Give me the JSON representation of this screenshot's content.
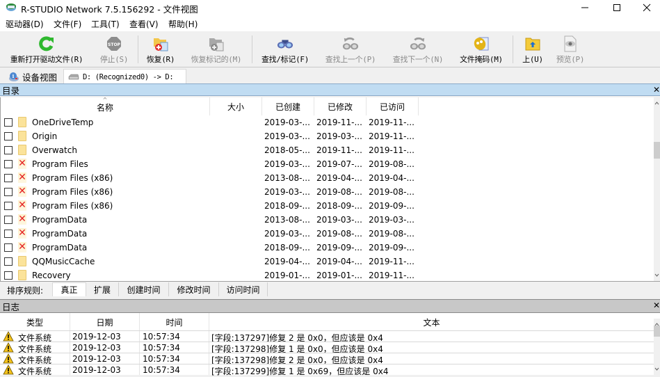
{
  "window": {
    "title": "R-STUDIO Network 7.5.156292 - 文件视图",
    "controls": {
      "minimize": "—",
      "maximize": "☐",
      "close": "✕"
    }
  },
  "menu": [
    {
      "label": "驱动器(D)"
    },
    {
      "label": "文件(F)"
    },
    {
      "label": "工具(T)"
    },
    {
      "label": "查看(V)"
    },
    {
      "label": "帮助(H)"
    }
  ],
  "toolbar": [
    {
      "label": "重新打开驱动文件(R)",
      "icon": "refresh-icon",
      "enabled": true
    },
    {
      "label": "停止(S)",
      "icon": "stop-icon",
      "enabled": false
    },
    {
      "label": "恢复(R)",
      "icon": "recover-icon",
      "enabled": true
    },
    {
      "label": "恢复标记的(M)",
      "icon": "recover-marked-icon",
      "enabled": false
    },
    {
      "label": "查找/标记(F)",
      "icon": "binoculars-icon",
      "enabled": true
    },
    {
      "label": "查找上一个(P)",
      "icon": "find-previous-icon",
      "enabled": false
    },
    {
      "label": "查找下一个(N)",
      "icon": "find-next-icon",
      "enabled": false
    },
    {
      "label": "文件掩码(M)",
      "icon": "file-mask-icon",
      "enabled": true
    },
    {
      "label": "上(U)",
      "icon": "folder-up-icon",
      "enabled": true
    },
    {
      "label": "预览(P)",
      "icon": "preview-icon",
      "enabled": false
    }
  ],
  "tabs": [
    {
      "label": "设备视图",
      "icon": "device-view-icon",
      "active": false
    },
    {
      "label": "D: (Recognized0) -> D:",
      "icon": "drive-icon",
      "active": true
    }
  ],
  "directory": {
    "title": "目录",
    "close": "✕",
    "columns": [
      "名称",
      "大小",
      "已创建",
      "已修改",
      "已访问"
    ],
    "rows": [
      {
        "name": "OneDriveTemp",
        "deleted": false,
        "size": "",
        "created": "2019-03-...",
        "modified": "2019-11-...",
        "accessed": "2019-11-..."
      },
      {
        "name": "Origin",
        "deleted": false,
        "size": "",
        "created": "2019-03-...",
        "modified": "2019-03-...",
        "accessed": "2019-11-..."
      },
      {
        "name": "Overwatch",
        "deleted": false,
        "size": "",
        "created": "2018-05-...",
        "modified": "2019-11-...",
        "accessed": "2019-11-..."
      },
      {
        "name": "Program Files",
        "deleted": true,
        "size": "",
        "created": "2019-03-...",
        "modified": "2019-07-...",
        "accessed": "2019-08-..."
      },
      {
        "name": "Program Files (x86)",
        "deleted": true,
        "size": "",
        "created": "2013-08-...",
        "modified": "2019-04-...",
        "accessed": "2019-04-..."
      },
      {
        "name": "Program Files (x86)",
        "deleted": true,
        "size": "",
        "created": "2019-03-...",
        "modified": "2019-08-...",
        "accessed": "2019-08-..."
      },
      {
        "name": "Program Files (x86)",
        "deleted": true,
        "size": "",
        "created": "2018-09-...",
        "modified": "2018-09-...",
        "accessed": "2019-09-..."
      },
      {
        "name": "ProgramData",
        "deleted": true,
        "size": "",
        "created": "2013-08-...",
        "modified": "2019-03-...",
        "accessed": "2019-03-..."
      },
      {
        "name": "ProgramData",
        "deleted": true,
        "size": "",
        "created": "2019-03-...",
        "modified": "2019-08-...",
        "accessed": "2019-08-..."
      },
      {
        "name": "ProgramData",
        "deleted": true,
        "size": "",
        "created": "2018-09-...",
        "modified": "2019-09-...",
        "accessed": "2019-09-..."
      },
      {
        "name": "QQMusicCache",
        "deleted": false,
        "size": "",
        "created": "2019-04-...",
        "modified": "2019-04-...",
        "accessed": "2019-11-..."
      },
      {
        "name": "Recovery",
        "deleted": false,
        "size": "",
        "created": "2019-01-...",
        "modified": "2019-01-...",
        "accessed": "2019-11-..."
      }
    ]
  },
  "sort": {
    "label": "排序规则:",
    "options": [
      {
        "label": "真正",
        "active": true
      },
      {
        "label": "扩展",
        "active": false
      },
      {
        "label": "创建时间",
        "active": false
      },
      {
        "label": "修改时间",
        "active": false
      },
      {
        "label": "访问时间",
        "active": false
      }
    ]
  },
  "log": {
    "title": "日志",
    "close": "✕",
    "columns": [
      "类型",
      "日期",
      "时间",
      "文本"
    ],
    "rows": [
      {
        "type": "文件系统",
        "date": "2019-12-03",
        "time": "10:57:34",
        "text": "[字段:137297]修复 2 是 0x0，但应该是 0x4"
      },
      {
        "type": "文件系统",
        "date": "2019-12-03",
        "time": "10:57:34",
        "text": "[字段:137298]修复 1 是 0x0，但应该是 0x4"
      },
      {
        "type": "文件系统",
        "date": "2019-12-03",
        "time": "10:57:34",
        "text": "[字段:137298]修复 2 是 0x0，但应该是 0x4"
      },
      {
        "type": "文件系统",
        "date": "2019-12-03",
        "time": "10:57:34",
        "text": "[字段:137299]修复 1 是 0x69，但应该是 0x4"
      }
    ]
  },
  "colors": {
    "panel_header_dir": "#c0dcf2",
    "panel_header_log": "#c8c8c8",
    "deleted_mark": "#e52222",
    "folder": "#fbe39a"
  }
}
